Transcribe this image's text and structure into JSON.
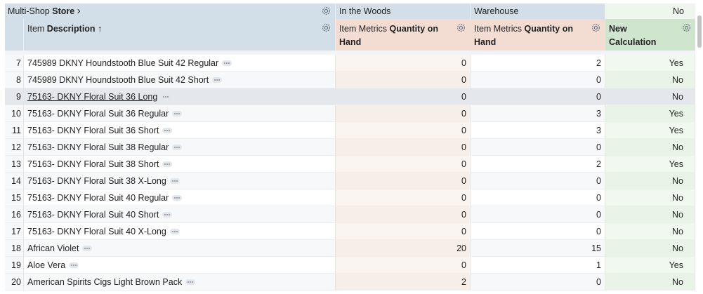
{
  "header": {
    "group_label": "Multi-Shop",
    "group_label_bold": "Store",
    "chevron": "›",
    "store_a": "In the Woods",
    "store_b": "Warehouse",
    "store_c": "No",
    "col_desc_prefix": "Item",
    "col_desc_bold": "Description",
    "col_desc_sort": "↑",
    "col_qty_a_prefix": "Item Metrics",
    "col_qty_a_bold": "Quantity on Hand",
    "col_qty_b_prefix": "Item Metrics",
    "col_qty_b_bold": "Quantity on Hand",
    "col_new_bold": "New Calculation"
  },
  "icons": {
    "settings": "gear-icon",
    "more": "more-icon",
    "sort": "sort-ascending-icon"
  },
  "colors": {
    "header_blue": "#d2dfe9",
    "header_peach": "#f3ddd2",
    "header_green": "#cfe5cd"
  },
  "rows": [
    {
      "index": "7",
      "desc": "745989 DKNY Houndstooth Blue Suit 42 Regular",
      "qty_a": "0",
      "qty_b": "2",
      "new": "Yes"
    },
    {
      "index": "8",
      "desc": "745989 DKNY Houndstooth Blue Suit 42 Short",
      "qty_a": "0",
      "qty_b": "0",
      "new": "No"
    },
    {
      "index": "9",
      "desc": "75163- DKNY Floral Suit 36 Long",
      "qty_a": "0",
      "qty_b": "0",
      "new": "No",
      "selected": true
    },
    {
      "index": "10",
      "desc": "75163- DKNY Floral Suit 36 Regular",
      "qty_a": "0",
      "qty_b": "3",
      "new": "Yes"
    },
    {
      "index": "11",
      "desc": "75163- DKNY Floral Suit 36 Short",
      "qty_a": "0",
      "qty_b": "3",
      "new": "Yes"
    },
    {
      "index": "12",
      "desc": "75163- DKNY Floral Suit 38 Regular",
      "qty_a": "0",
      "qty_b": "0",
      "new": "No"
    },
    {
      "index": "13",
      "desc": "75163- DKNY Floral Suit 38 Short",
      "qty_a": "0",
      "qty_b": "2",
      "new": "Yes"
    },
    {
      "index": "14",
      "desc": "75163- DKNY Floral Suit 38 X-Long",
      "qty_a": "0",
      "qty_b": "0",
      "new": "No"
    },
    {
      "index": "15",
      "desc": "75163- DKNY Floral Suit 40 Regular",
      "qty_a": "0",
      "qty_b": "0",
      "new": "No"
    },
    {
      "index": "16",
      "desc": "75163- DKNY Floral Suit 40 Short",
      "qty_a": "0",
      "qty_b": "0",
      "new": "No"
    },
    {
      "index": "17",
      "desc": "75163- DKNY Floral Suit 40 X-Long",
      "qty_a": "0",
      "qty_b": "0",
      "new": "No"
    },
    {
      "index": "18",
      "desc": "African Violet",
      "qty_a": "20",
      "qty_b": "15",
      "new": "No"
    },
    {
      "index": "19",
      "desc": "Aloe Vera",
      "qty_a": "0",
      "qty_b": "1",
      "new": "Yes"
    },
    {
      "index": "20",
      "desc": "American Spirits Cigs Light Brown Pack",
      "qty_a": "2",
      "qty_b": "0",
      "new": "No"
    }
  ]
}
